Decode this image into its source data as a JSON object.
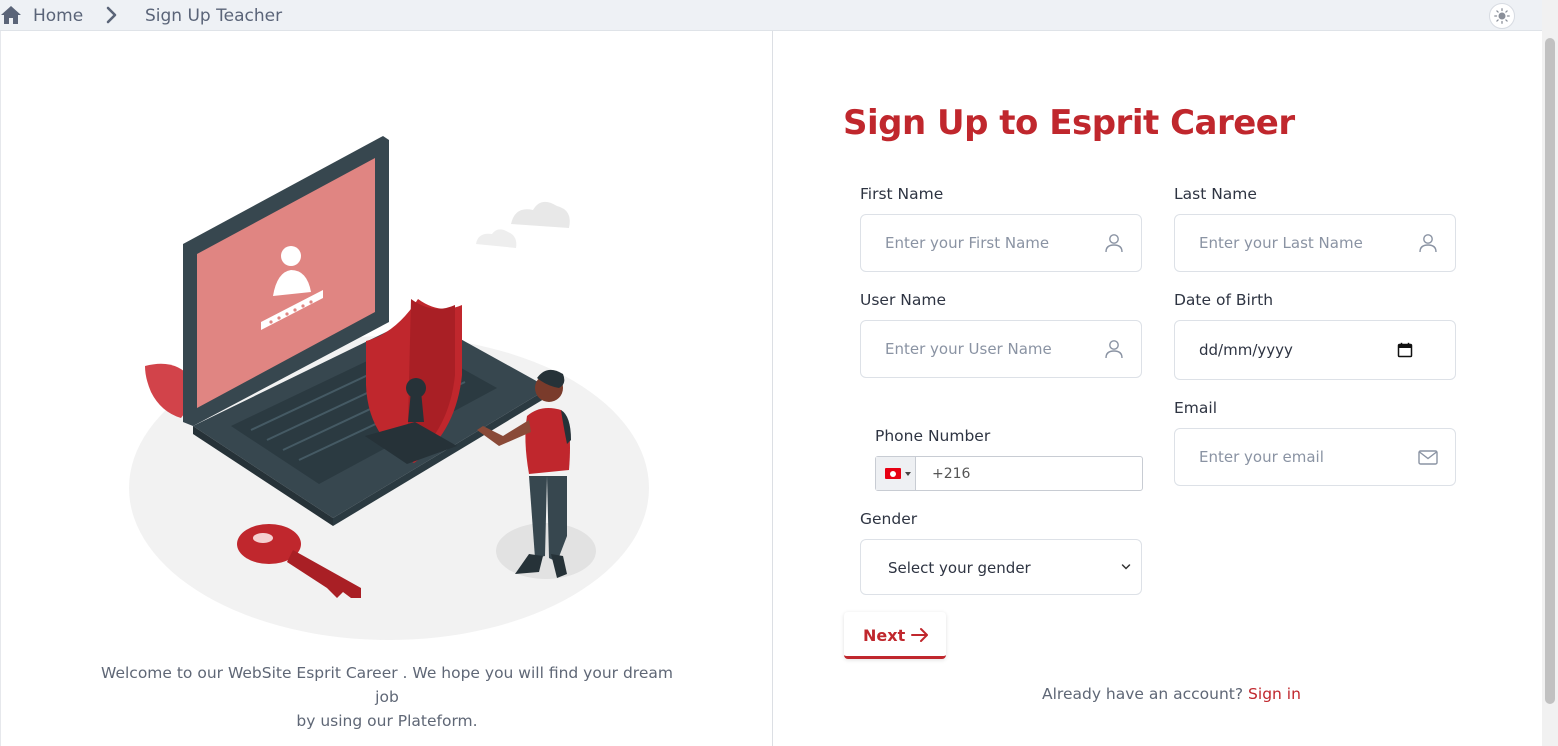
{
  "breadcrumb": {
    "home_label": "Home",
    "current_label": "Sign Up Teacher"
  },
  "left": {
    "welcome_line1": "Welcome to our WebSite Esprit Career . We hope you will find your dream job",
    "welcome_line2": "by using our Plateform."
  },
  "form": {
    "title": "Sign Up to Esprit Career",
    "first_name": {
      "label": "First Name",
      "placeholder": "Enter your First Name"
    },
    "last_name": {
      "label": "Last Name",
      "placeholder": "Enter your Last Name"
    },
    "user_name": {
      "label": "User Name",
      "placeholder": "Enter your User Name"
    },
    "dob": {
      "label": "Date of Birth",
      "value": "dd/mm/yyyy"
    },
    "email": {
      "label": "Email",
      "placeholder": "Enter your email"
    },
    "phone": {
      "label": "Phone Number",
      "code": "+216"
    },
    "gender": {
      "label": "Gender",
      "selected": "Select your gender"
    },
    "next_label": "Next",
    "account_prompt": "Already have an account?",
    "signin_label": "Sign in"
  },
  "colors": {
    "accent": "#c0272d",
    "topbar": "#eef1f5"
  }
}
